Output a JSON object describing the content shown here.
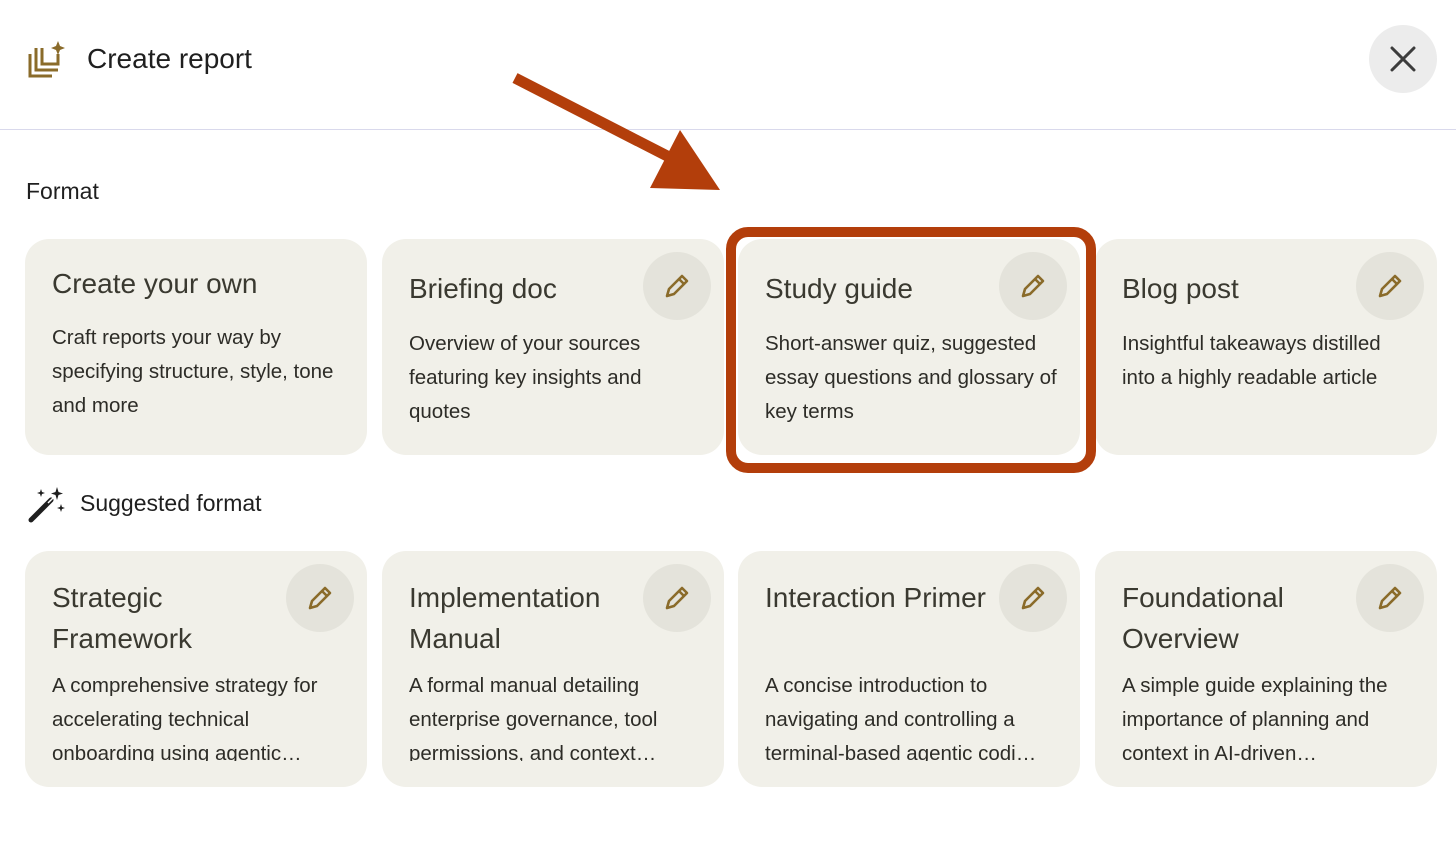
{
  "header": {
    "title": "Create report",
    "close_icon": "close-icon",
    "report_icon": "report-sparkle-icon"
  },
  "format_section": {
    "title": "Format",
    "cards": [
      {
        "title": "Create your own",
        "description": "Craft reports your way by specifying structure, style, tone and more",
        "has_edit": false
      },
      {
        "title": "Briefing doc",
        "description": "Overview of your sources featuring key insights and quotes",
        "has_edit": true
      },
      {
        "title": "Study guide",
        "description": "Short-answer quiz, suggested essay questions and glossary of key terms",
        "has_edit": true,
        "highlighted": true
      },
      {
        "title": "Blog post",
        "description": "Insightful takeaways distilled into a highly readable article",
        "has_edit": true
      }
    ]
  },
  "suggested_section": {
    "title": "Suggested format",
    "icon": "magic-wand-icon",
    "cards": [
      {
        "title": "Strategic Framework",
        "description": "A comprehensive strategy for accelerating technical onboarding using agentic…"
      },
      {
        "title": "Implementation Manual",
        "description": "A formal manual detailing enterprise governance, tool permissions, and context…"
      },
      {
        "title": "Interaction Primer",
        "description": "A concise introduction to navigating and controlling a terminal-based agentic codi…"
      },
      {
        "title": "Foundational Overview",
        "description": "A simple guide explaining the importance of planning and context in AI-driven…"
      }
    ]
  },
  "colors": {
    "card_bg": "#f1f0e9",
    "edit_button_bg": "#e4e3db",
    "icon_gold": "#8a6b2a",
    "annotation_red": "#b33e0b"
  }
}
